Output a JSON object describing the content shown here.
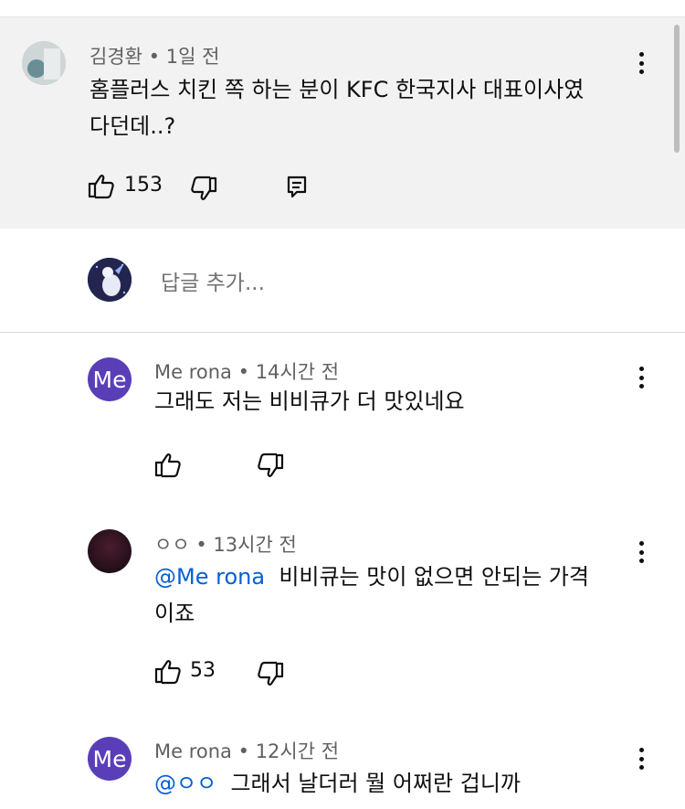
{
  "parent_comment": {
    "author": "김경환",
    "time": "1일 전",
    "text_line1": "홈플러스 치킨 쪽 하는 분이 KFC 한국지사 대표이사였",
    "text_line2": "다던데..?",
    "likes": "153"
  },
  "reply_box": {
    "placeholder": "답글 추가..."
  },
  "replies": [
    {
      "author": "Me rona",
      "time": "14시간 전",
      "avatar_text": "Me",
      "text": "그래도 저는 비비큐가 더 맛있네요"
    },
    {
      "author": "ㅇㅇ",
      "time": "13시간 전",
      "mention": "@Me rona",
      "text_line1": "비비큐는 맛이 없으면 안되는 가격",
      "text_line2": "이죠",
      "likes": "53"
    },
    {
      "author": "Me rona",
      "time": "12시간 전",
      "avatar_text": "Me",
      "mention": "@ㅇㅇ",
      "text": "그래서 날더러 뭘 어쩌란 겁니까"
    }
  ],
  "separator": "•",
  "colors": {
    "mention": "#065fd4",
    "avatar_me": "#5a3eb8",
    "highlight_bg": "#f2f2f2"
  }
}
